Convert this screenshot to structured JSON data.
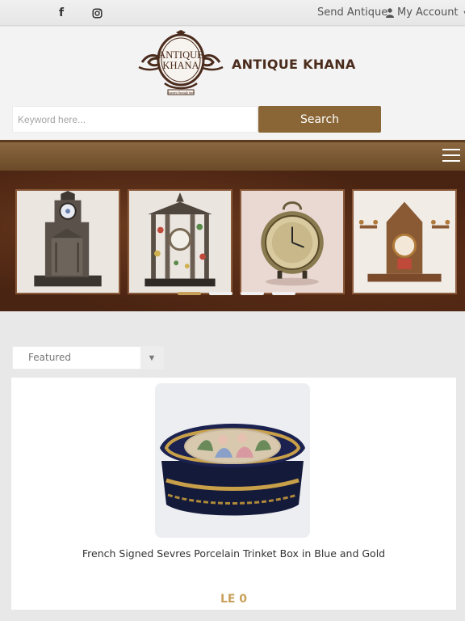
{
  "topbar": {
    "social": [
      {
        "icon": "facebook-icon",
        "glyph": "f"
      },
      {
        "icon": "instagram-icon"
      }
    ],
    "send_antique": "Send Antique",
    "my_account": "My Account"
  },
  "header": {
    "logo_line1": "ANTIQUE",
    "logo_line2": "KHANA",
    "logo_tagline": "Journey through time",
    "brand_name": "ANTIQUE KHANA"
  },
  "search": {
    "placeholder": "Keyword here...",
    "value": "",
    "button_label": "Search"
  },
  "carousel": {
    "slides": [
      "gothic-clock",
      "ornate-pillar-clock",
      "pocket-watch-clock",
      "mantel-clock"
    ],
    "dot_count": 4,
    "active_dot": 0
  },
  "sort": {
    "selected": "Featured"
  },
  "product": {
    "title": "French Signed Sevres Porcelain Trinket Box in Blue and Gold",
    "price": "LE 0"
  },
  "colors": {
    "accent": "#8a6535",
    "brand": "#4a2b1c",
    "price": "#c9a05a"
  }
}
